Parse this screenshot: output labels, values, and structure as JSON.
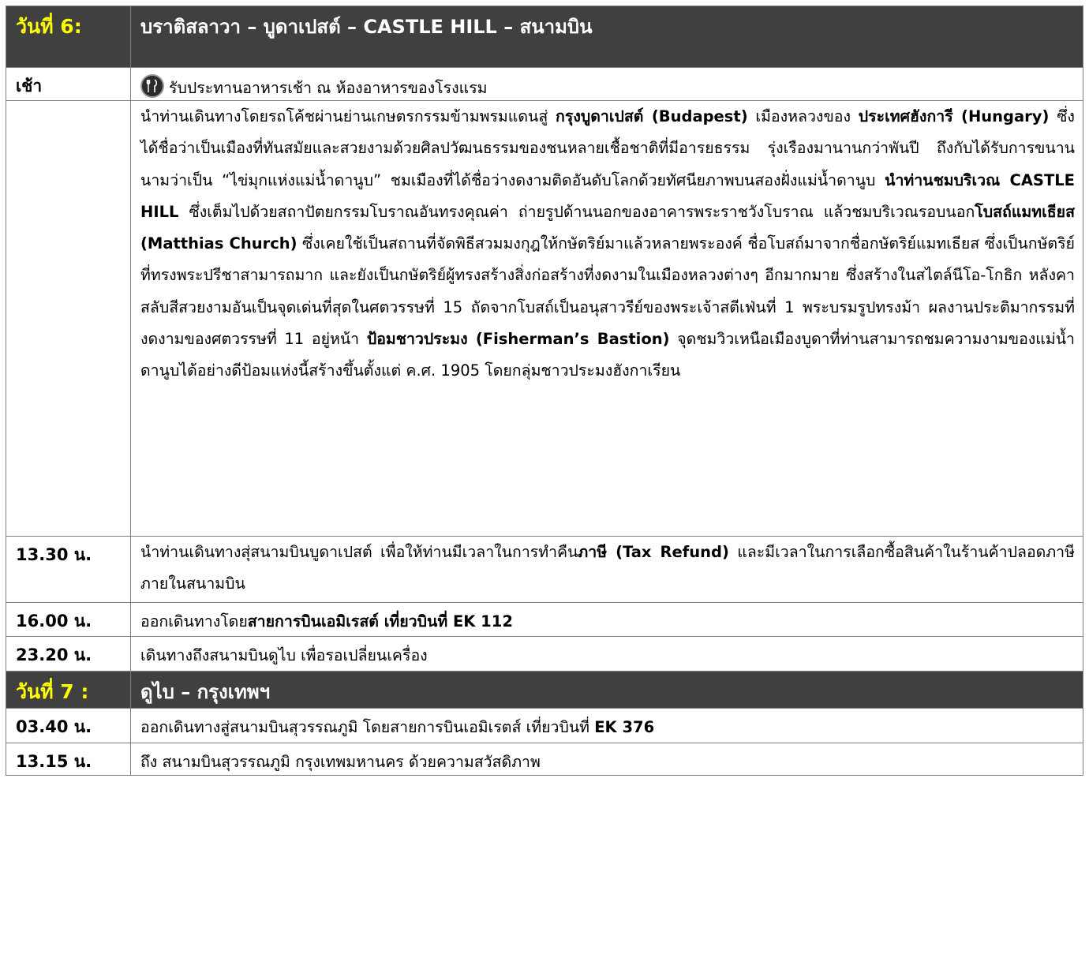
{
  "day6": {
    "label": "วันที่ 6:",
    "title": "บราติสลาวา – บูดาเปสต์ – CASTLE HILL – สนามบิน"
  },
  "breakfast": {
    "time": "เช้า",
    "icon": "restaurant-icon",
    "text": "รับประทานอาหารเช้า ณ ห้องอาหารของโรงแรม"
  },
  "main_paragraph": {
    "p1": "นำท่านเดินทางโดยรถโค้ชผ่านย่านเกษตรกรรมข้ามพรมแดนสู่ ",
    "b1": "กรุงบูดาเปสต์ (Budapest)",
    "p2": " เมืองหลวงของ ",
    "b2": "ประเทศฮังการี (Hungary)",
    "p3": " ซึ่งได้ชื่อว่าเป็นเมืองที่ทันสมัยและสวยงามด้วยศิลปวัฒนธรรมของชนหลายเชื้อชาติที่มีอารยธรรม รุ่งเรืองมานานกว่าพันปี ถึงกับได้รับการขนานนามว่าเป็น “ไข่มุกแห่งแม่น้ำดานูบ” ชมเมืองที่ได้ชื่อว่างดงามติดอันดับโลกด้วยทัศนียภาพบนสองฝั่งแม่น้ำดานูบ ",
    "b3": "นำท่านชมบริเวณ CASTLE HILL",
    "p4": " ซึ่งเต็มไปด้วยสถาปัตยกรรมโบราณอันทรงคุณค่า ถ่ายรูปด้านนอกของอาคารพระราชวังโบราณ แล้วชมบริเวณรอบนอก",
    "b4": "โบสถ์แมทเธียส (Matthias Church)",
    "p5": " ซึ่งเคยใช้เป็นสถานที่จัดพิธีสวมมงกุฎให้กษัตริย์มาแล้วหลายพระองค์ ชื่อโบสถ์มาจากชื่อกษัตริย์แมทเธียส ซึ่งเป็นกษัตริย์ที่ทรงพระปรีชาสามารถมาก และยังเป็นกษัตริย์ผู้ทรงสร้างสิ่งก่อสร้างที่งดงามในเมืองหลวงต่างๆ อีกมากมาย ซึ่งสร้างในสไตล์นีโอ-โกธิก หลังคาสลับสีสวยงามอันเป็นจุดเด่นที่สุดในศตวรรษที่ 15 ถัดจากโบสถ์เป็นอนุสาวรีย์ของพระเจ้าสตีเฟ่นที่ 1 พระบรมรูปทรงม้า ผลงานประติมากรรมที่งดงามของศตวรรษที่ 11 อยู่หน้า ",
    "b5": "ป้อมชาวประมง (Fisherman’s Bastion)",
    "p6": " จุดชมวิวเหนือเมืองบูดาที่ท่านสามารถชมความงามของแม่น้ำดานูบได้อย่างดีป้อมแห่งนี้สร้างขึ้นตั้งแต่ ค.ศ. 1905 โดยกลุ่มชาวประมงฮังกาเรียน"
  },
  "t1330": {
    "time": "13.30 น.",
    "p1": "นำท่านเดินทางสุ่สนามบินบูดาเปสต์ เพื่อให้ท่านมีเวลาในการทำคืน",
    "b1": "ภาษี (Tax Refund)",
    "p2": " และมีเวลาในการเลือกซื้อสินค้าในร้านค้าปลอดภาษีภายในสนามบิน"
  },
  "t1600": {
    "time": "16.00 น.",
    "p1": "ออกเดินทางโดย",
    "b1": "สายการบินเอมิเรสต์ เที่ยวบินที่ EK 112"
  },
  "t2320": {
    "time": "23.20 น.",
    "text": "เดินทางถึงสนามบินดูไบ เพื่อรอเปลี่ยนเครื่อง"
  },
  "day7": {
    "label": "วันที่ 7 :",
    "title": "ดูไบ – กรุงเทพฯ"
  },
  "t0340": {
    "time": "03.40 น.",
    "p1": "ออกเดินทางสู่สนามบินสุวรรณภูมิ โดยสายการบินเอมิเรตส์ เที่ยวบินที่ ",
    "b1": "EK 376"
  },
  "t1315": {
    "time": "13.15 น.",
    "text": "ถึง สนามบินสุวรรณภูมิ กรุงเทพมหานคร ด้วยความสวัสดิภาพ"
  }
}
